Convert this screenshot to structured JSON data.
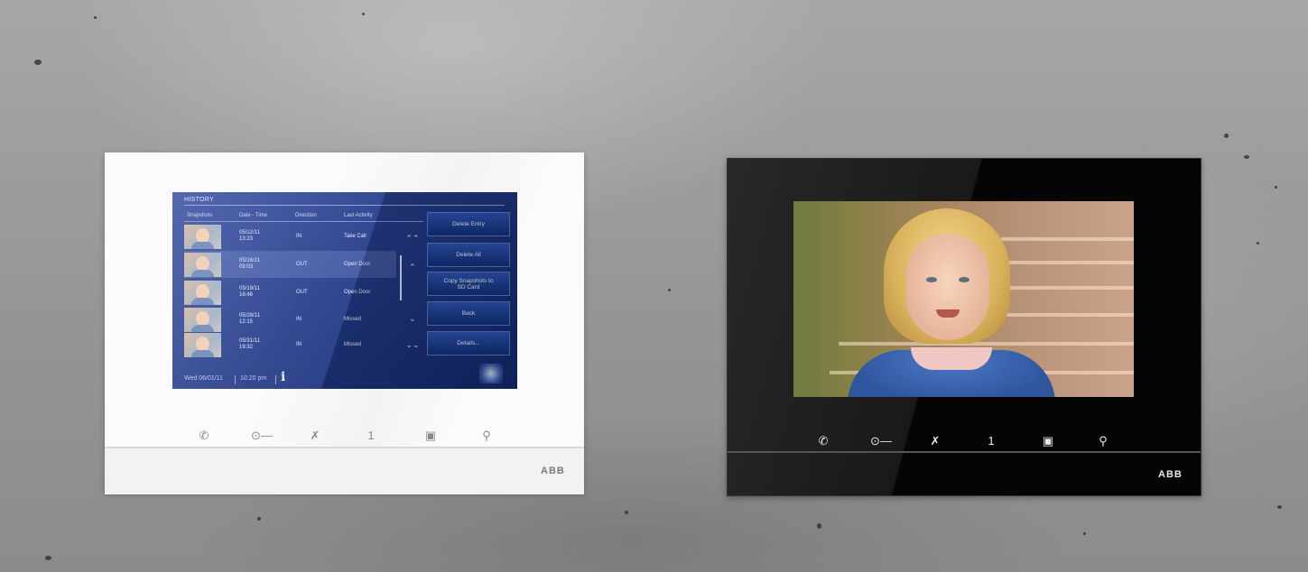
{
  "white_device": {
    "screen": {
      "title": "HISTORY",
      "columns": [
        "Snapshots",
        "Date - Time",
        "Direction",
        "Last Activity"
      ],
      "rows": [
        {
          "date": "05/12/11\n13:23",
          "direction": "IN",
          "activity": "Take Call"
        },
        {
          "date": "05/16/11\n09:03",
          "direction": "OUT",
          "activity": "Open Door"
        },
        {
          "date": "05/19/11\n16:46",
          "direction": "OUT",
          "activity": "Open Door"
        },
        {
          "date": "05/28/11\n12:15",
          "direction": "IN",
          "activity": "Missed"
        },
        {
          "date": "05/31/11\n19:32",
          "direction": "IN",
          "activity": "Missed"
        }
      ],
      "actions": [
        "Delete Entry",
        "Delete All",
        "Copy Snapshots to SD Card",
        "Back",
        "Details..."
      ],
      "footer_date": "Wed 06/01/11",
      "footer_time": "10:20 pm"
    },
    "controls": {
      "station_number": "1"
    },
    "brand": "ABB"
  },
  "black_device": {
    "controls": {
      "station_number": "1"
    },
    "brand": "ABB"
  },
  "colors": {
    "screen_blue": "#253c8a",
    "button_blue": "#1f44a0"
  },
  "icons": [
    "phone-icon",
    "key-icon",
    "mute-icon",
    "camera-frame-icon",
    "wrench-icon",
    "info-icon",
    "home-icon",
    "chevron-double-up-icon",
    "chevron-up-icon",
    "chevron-down-icon",
    "chevron-double-down-icon"
  ]
}
